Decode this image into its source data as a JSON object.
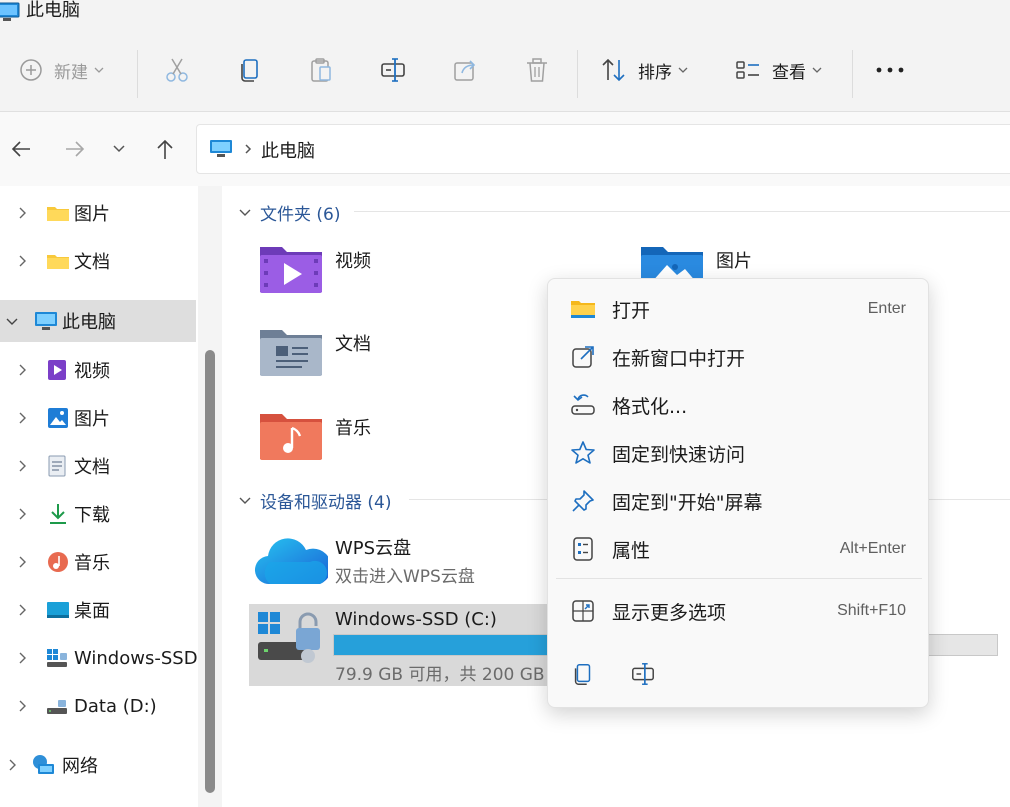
{
  "window": {
    "title": "此电脑"
  },
  "toolbar": {
    "new_label": "新建",
    "sort_label": "排序",
    "view_label": "查看",
    "more_label": "..."
  },
  "address": {
    "crumb": "此电脑"
  },
  "sidebar": {
    "items": [
      {
        "label": "图片"
      },
      {
        "label": "文档"
      },
      {
        "label": "此电脑"
      },
      {
        "label": "视频"
      },
      {
        "label": "图片"
      },
      {
        "label": "文档"
      },
      {
        "label": "下载"
      },
      {
        "label": "音乐"
      },
      {
        "label": "桌面"
      },
      {
        "label": "Windows-SSD"
      },
      {
        "label": "Data (D:)"
      },
      {
        "label": "网络"
      }
    ]
  },
  "content": {
    "folders_header": "文件夹 (6)",
    "folders": [
      {
        "name": "视频"
      },
      {
        "name": "图片"
      },
      {
        "name": "文档"
      },
      {
        "name": "音乐"
      }
    ],
    "devices_header": "设备和驱动器 (4)",
    "devices": [
      {
        "name": "WPS云盘",
        "sub": "双击进入WPS云盘"
      },
      {
        "name": "Windows-SSD (C:)",
        "sub": "79.9 GB 可用，共 200 GB",
        "used_fraction": 0.6
      }
    ]
  },
  "context_menu": {
    "items": [
      {
        "label": "打开",
        "accel": "Enter"
      },
      {
        "label": "在新窗口中打开",
        "accel": ""
      },
      {
        "label": "格式化...",
        "accel": ""
      },
      {
        "label": "固定到快速访问",
        "accel": ""
      },
      {
        "label": "固定到\"开始\"屏幕",
        "accel": ""
      },
      {
        "label": "属性",
        "accel": "Alt+Enter"
      },
      {
        "label": "显示更多选项",
        "accel": "Shift+F10"
      }
    ]
  },
  "colors": {
    "accent": "#26a0da",
    "header_text": "#2b5797",
    "selection": "#dedede"
  }
}
